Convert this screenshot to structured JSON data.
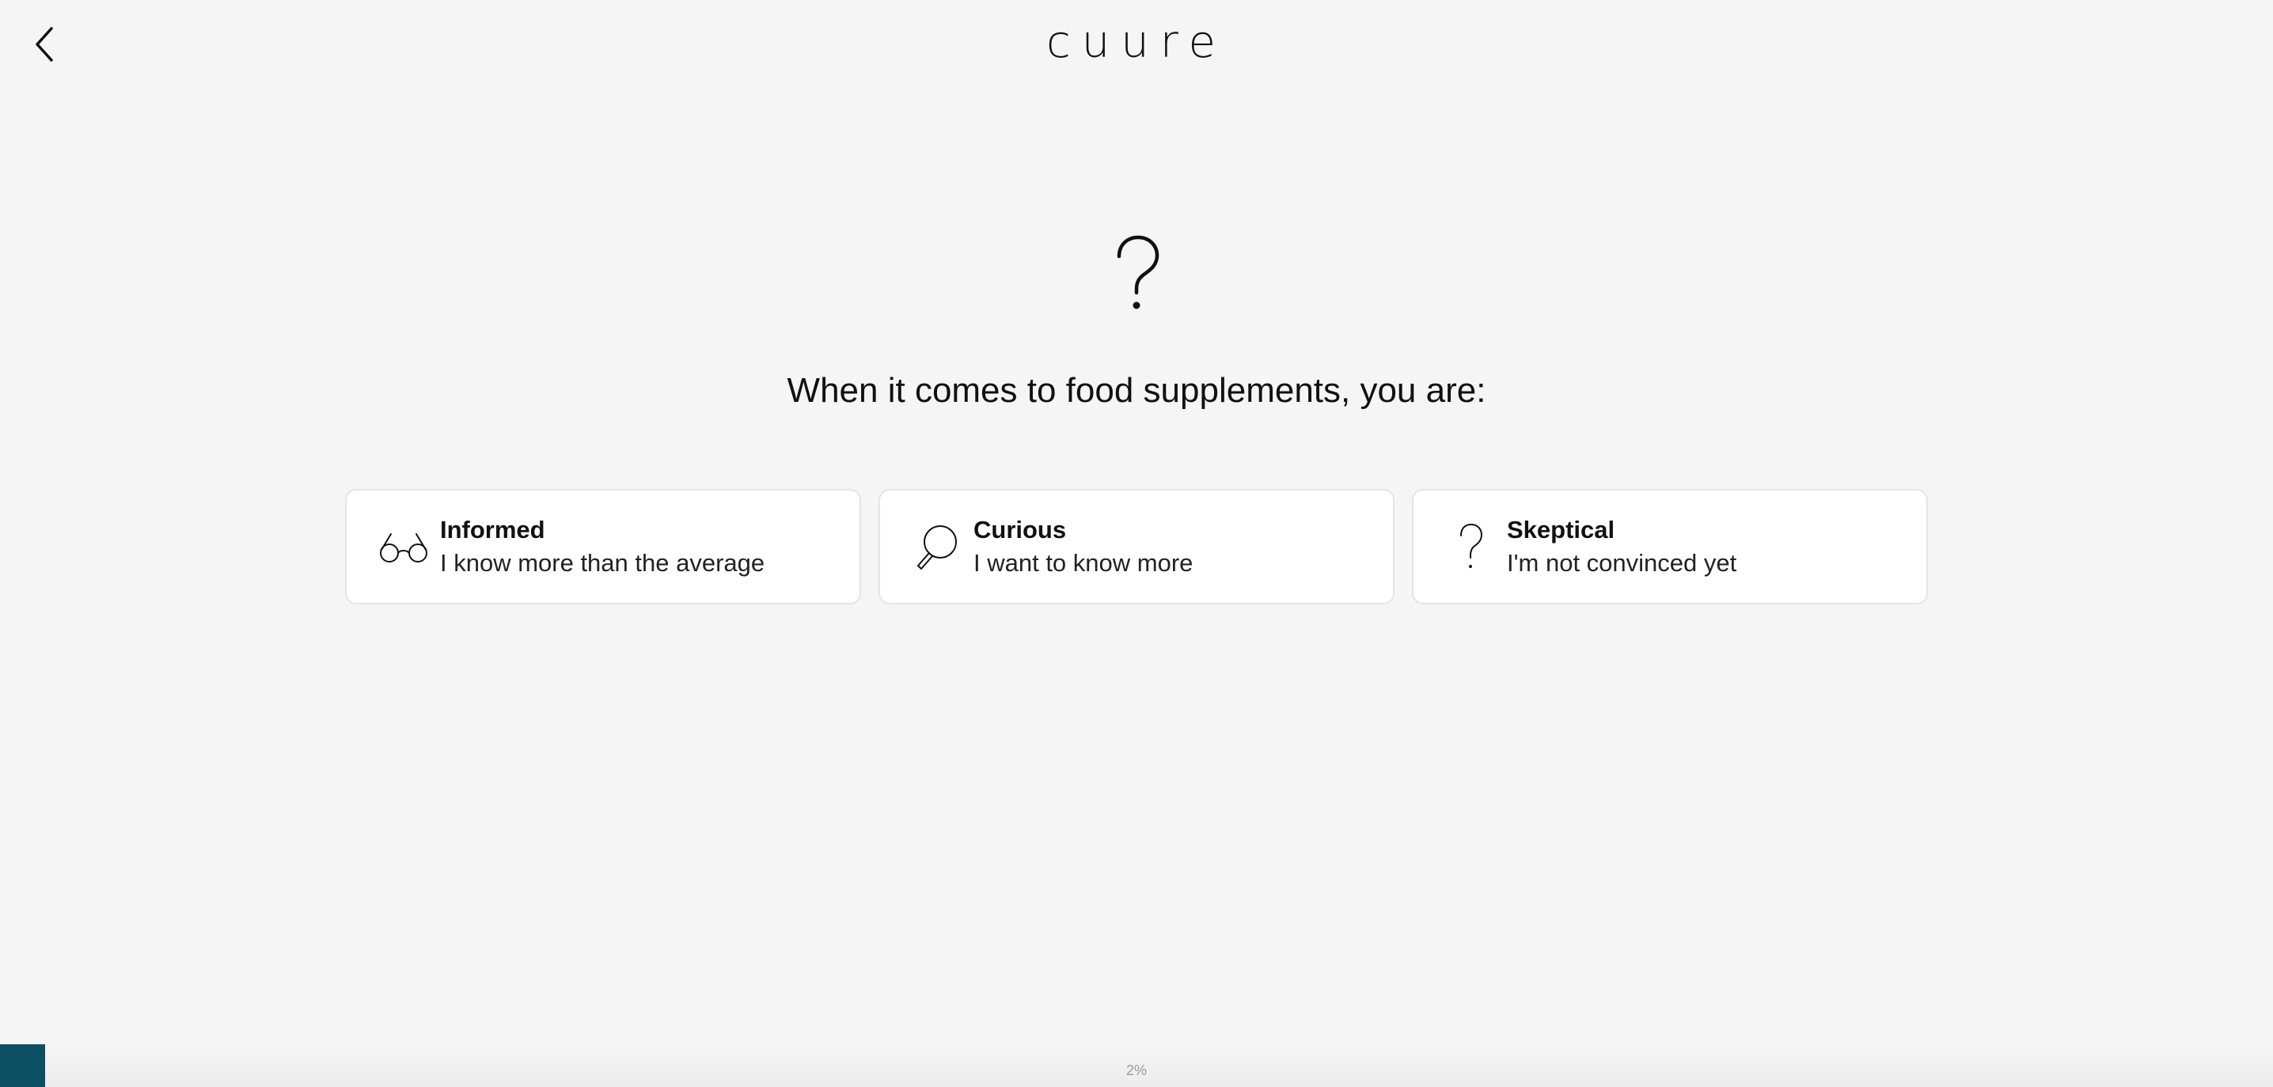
{
  "header": {
    "logo_text": "cuure",
    "back_icon": "chevron-left-icon"
  },
  "hero": {
    "icon": "question-mark-icon"
  },
  "question": {
    "title": "When it comes to food supplements, you are:"
  },
  "options": [
    {
      "icon": "glasses-icon",
      "title": "Informed",
      "subtitle": "I know more than the average"
    },
    {
      "icon": "magnifier-icon",
      "title": "Curious",
      "subtitle": "I want to know more"
    },
    {
      "icon": "question-mark-icon",
      "title": "Skeptical",
      "subtitle": "I'm not convinced yet"
    }
  ],
  "progress": {
    "label": "2%",
    "value_percent": 2,
    "fill_color": "#0c4f63"
  }
}
